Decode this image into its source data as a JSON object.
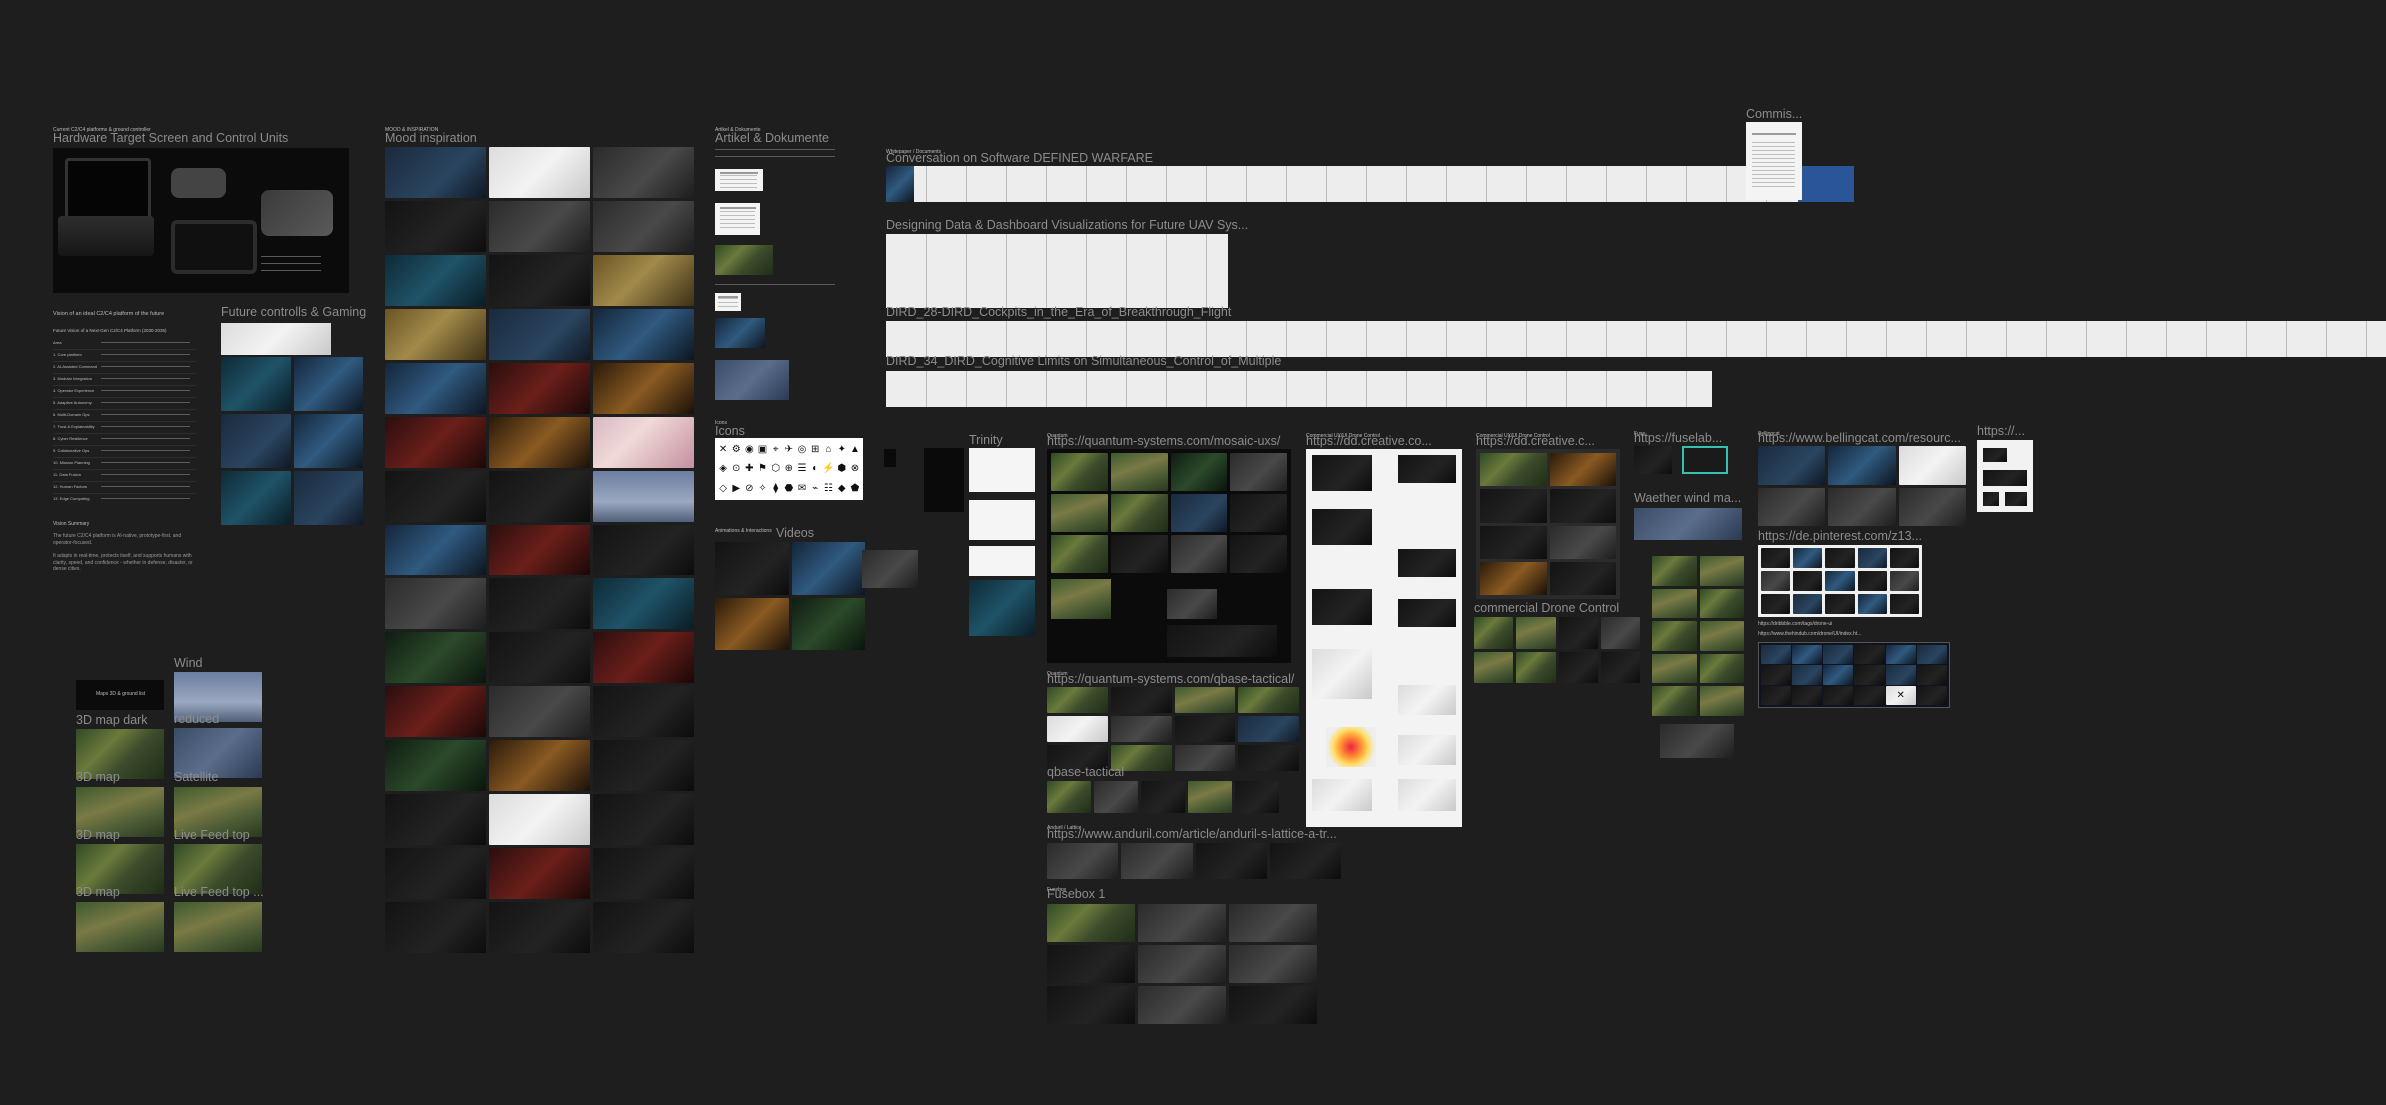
{
  "labels": {
    "hardware_small": "Current C2/C4 platforms & ground controller",
    "hardware": "Hardware Target Screen and Control Units",
    "vision_small": "Vision of an ideal C2/C4 platform of the future",
    "vision_heading": "Future Vision of a Next-Gen C2/C4 Platform (2030-2035)",
    "vision_summary_heading": "Vision Summary",
    "vision_summary_1": "The future C2/C4 platform is AI-native, prototype-first, and operator-focused.",
    "vision_summary_2": "It adapts in real-time, protects itself, and supports humans with clarity, speed, and confidence - whether in defense, disaster, or dense cities.",
    "future_controls": "Future controlls & Gaming",
    "mood_small": "MOOD & INSPIRATION",
    "mood": "Mood inspiration",
    "artikel_small": "Artikel & Dokumente",
    "artikel": "Artikel & Dokumente",
    "icons": "Icons",
    "videos_small": "Animations & Interactions",
    "videos": "Videos",
    "sdw_small": "Whitepaper / Documents",
    "sdw": "Conversation on Software DEFINED WARFARE",
    "designing": "Designing Data & Dashboard Visualizations for Future UAV Sys...",
    "dird28": "DIRD_28-DIRD_Cockpits_in_the_Era_of_Breakthrough_Flight",
    "dird34": "DIRD_34_DIRD_Cognitive Limits on Simultaneous_Control_of_Multiple",
    "commis": "Commis...",
    "trinity": "Trinity",
    "quantum_small": "Quantum",
    "quantum_url": "https://quantum-systems.com/mosaic-uxs/",
    "qbase_small": "Quantum",
    "qbase_url": "https://quantum-systems.com/qbase-tactical/",
    "qbase_tactical": "qbase-tactical",
    "anduril_small": "Anduril / Lattice",
    "anduril_url": "https://www.anduril.com/article/anduril-s-lattice-a-tr...",
    "fusebox_small": "Fusebox",
    "fusebox": "Fusebox 1",
    "dd_small": "Commercial UX/UI Drone Control",
    "dd_url": "https://dd.creative.co...",
    "dd2_small": "Commercial UX/UI Drone Control",
    "dd2_url": "https://dd.creative.c...",
    "commercial": "commercial Drone Control",
    "fuse_small": "Fuse",
    "fuse_url": "https://fuselab...",
    "weather": "Waether wind ma...",
    "bellingcat_small": "Bellingcat",
    "bellingcat_url": "https://www.bellingcat.com/resourc...",
    "pinterest_url": "https://de.pinterest.com/z13...",
    "pinterest_links": "https://dribbble.com/tags/drone-ui",
    "pinterest_links2": "https://www.thehindub.com/drone/UI/index.ht...",
    "https_small": "https://...",
    "wind": "Wind",
    "reduced": "reduced",
    "satellite": "Satellite",
    "livefeed": "Live Feed top",
    "livefeed2": "Live Feed top ...",
    "map_ground_title": "Maps 3D & ground list",
    "map3d_dark": "3D map dark",
    "map3d": "3D map",
    "map3d_b": "3D map",
    "map3d_c": "3D map"
  },
  "vision_rows": [
    "Area",
    "1. Core platform",
    "2. AI-Assisted Command",
    "3. Modular Integration",
    "4. Operator Experience",
    "5. Adaptive Autonomy",
    "6. Multi-Domain Ops",
    "7. Trust & Explainability",
    "8. Cyber Resilience",
    "9. Collaborative Ops",
    "10. Mission Planning",
    "11. Data Fusion",
    "12. Human Factors",
    "13. Edge Computing"
  ],
  "icon_glyphs": [
    "✕",
    "⚙",
    "◉",
    "▣",
    "⌖",
    "✈",
    "◎",
    "⊞",
    "⌂",
    "✦",
    "▲",
    "◈",
    "⊙",
    "✚",
    "⚑",
    "⬡",
    "⊕",
    "☰",
    "◐",
    "⚡",
    "⬢",
    "⊗",
    "◇",
    "▶",
    "⊘",
    "✧",
    "⧫",
    "⬣",
    "✉",
    "⌁",
    "☷",
    "◆",
    "⬟"
  ],
  "close_glyph": "✕"
}
